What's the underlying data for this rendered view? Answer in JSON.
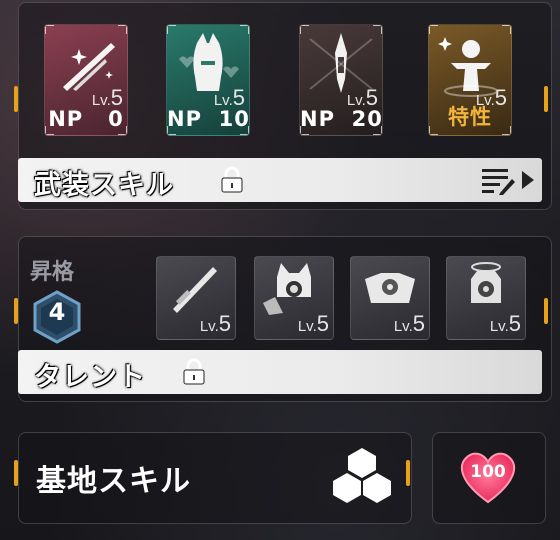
{
  "weapon_skills": {
    "cards": [
      {
        "np_label": "NP",
        "np_value": "0",
        "lv_prefix": "Lv.",
        "lv_value": "5",
        "icon": "sparkle-sword-icon",
        "bg": "#7a3845"
      },
      {
        "np_label": "NP",
        "np_value": "10",
        "lv_prefix": "Lv.",
        "lv_value": "5",
        "icon": "robot-mask-icon",
        "bg": "#1f5a52"
      },
      {
        "np_label": "NP",
        "np_value": "20",
        "lv_prefix": "Lv.",
        "lv_value": "5",
        "icon": "blade-weapon-icon",
        "bg": "#3a3030"
      },
      {
        "np_label": "特性",
        "np_value": "",
        "lv_prefix": "Lv.",
        "lv_value": "5",
        "icon": "figure-trait-icon",
        "bg": "#6a4a1e"
      }
    ],
    "bar_label": "武装スキル",
    "np_color": "#ffffff",
    "trait_color": "#f2b43a"
  },
  "ascension": {
    "label": "昇格",
    "level": "4",
    "talents": [
      {
        "lv_prefix": "Lv.",
        "lv_value": "5",
        "icon": "sword-talent-icon"
      },
      {
        "lv_prefix": "Lv.",
        "lv_value": "5",
        "icon": "cat-robot-talent-icon"
      },
      {
        "lv_prefix": "Lv.",
        "lv_value": "5",
        "icon": "gear-fist-talent-icon"
      },
      {
        "lv_prefix": "Lv.",
        "lv_value": "5",
        "icon": "halo-robot-talent-icon"
      }
    ],
    "bar_label": "タレント"
  },
  "base_skill": {
    "label": "基地スキル",
    "affection_value": "100"
  },
  "colors": {
    "accent": "#e8a21a",
    "heart": "#ff4f78"
  }
}
